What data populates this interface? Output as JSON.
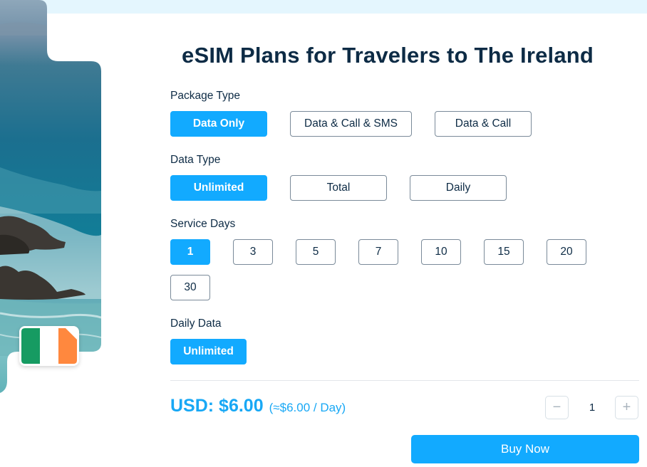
{
  "header": {
    "title": "eSIM Plans for Travelers to The Ireland"
  },
  "hero": {
    "image": "coastal-sea-rocks-photo",
    "flag_icon": "ireland-flag-sim-icon",
    "flag_colors": [
      "#169b62",
      "#ffffff",
      "#ff883e"
    ]
  },
  "package_type": {
    "label": "Package Type",
    "options": [
      {
        "label": "Data Only",
        "selected": true
      },
      {
        "label": "Data & Call & SMS",
        "selected": false
      },
      {
        "label": "Data & Call",
        "selected": false
      }
    ]
  },
  "data_type": {
    "label": "Data Type",
    "options": [
      {
        "label": "Unlimited",
        "selected": true
      },
      {
        "label": "Total",
        "selected": false
      },
      {
        "label": "Daily",
        "selected": false
      }
    ]
  },
  "service_days": {
    "label": "Service Days",
    "options": [
      {
        "label": "1",
        "selected": true
      },
      {
        "label": "3",
        "selected": false
      },
      {
        "label": "5",
        "selected": false
      },
      {
        "label": "7",
        "selected": false
      },
      {
        "label": "10",
        "selected": false
      },
      {
        "label": "15",
        "selected": false
      },
      {
        "label": "20",
        "selected": false
      },
      {
        "label": "30",
        "selected": false
      }
    ]
  },
  "daily_data": {
    "label": "Daily Data",
    "options": [
      {
        "label": "Unlimited",
        "selected": true
      }
    ]
  },
  "pricing": {
    "total": "USD: $6.00",
    "per_day": "(≈$6.00 / Day)"
  },
  "quantity": {
    "decrement_icon": "−",
    "value": "1",
    "increment_icon": "+"
  },
  "buy_button": {
    "label": "Buy Now"
  },
  "colors": {
    "accent": "#12aaff",
    "text_dark": "#0d2b45",
    "top_strip": "#e4f6fe"
  }
}
